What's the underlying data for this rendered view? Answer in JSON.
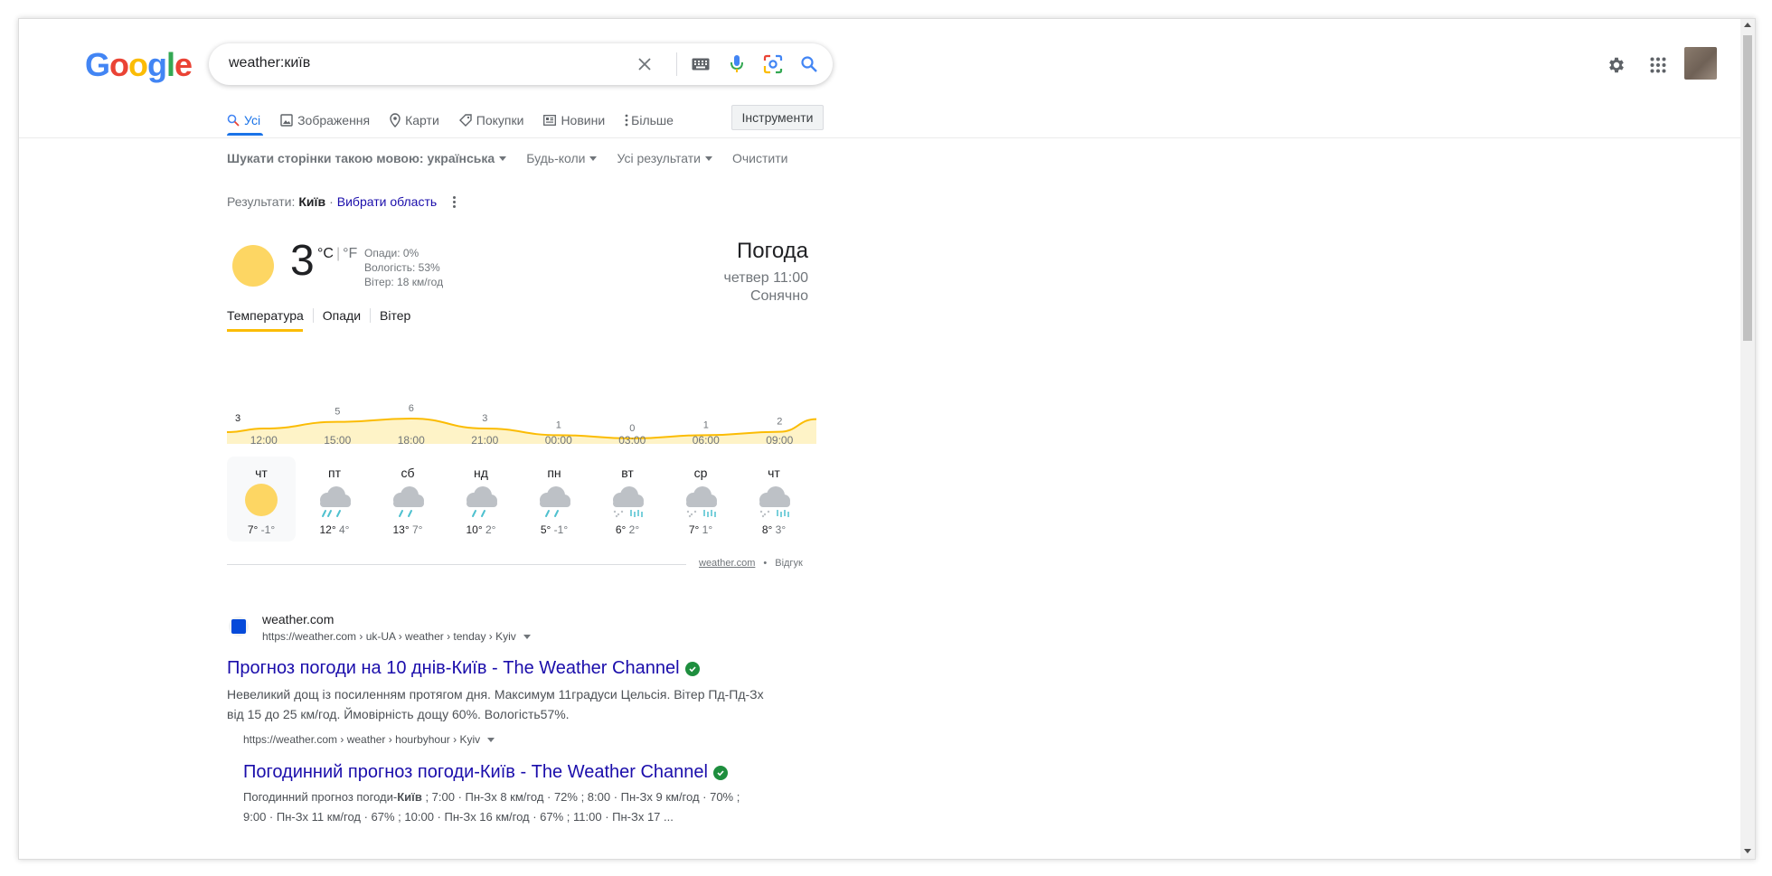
{
  "logo": {
    "text": "Google",
    "colors": [
      "#4285F4",
      "#EA4335",
      "#FBBC05",
      "#4285F4",
      "#34A853",
      "#EA4335"
    ]
  },
  "search": {
    "value": "weather:київ",
    "icons": [
      "close-icon",
      "keyboard-icon",
      "mic-icon",
      "lens-icon",
      "search-icon"
    ]
  },
  "header_right": {
    "icons": [
      "gear-icon",
      "apps-grid-icon",
      "avatar"
    ]
  },
  "tabs": [
    {
      "label": "Усі",
      "icon": "search-icon",
      "active": true
    },
    {
      "label": "Зображення",
      "icon": "image-icon"
    },
    {
      "label": "Карти",
      "icon": "map-pin-icon"
    },
    {
      "label": "Покупки",
      "icon": "tag-icon"
    },
    {
      "label": "Новини",
      "icon": "news-icon"
    },
    {
      "label": "Більше",
      "icon": "more-vert-icon"
    }
  ],
  "tools_label": "Інструменти",
  "filters": [
    {
      "label": "Шукати сторінки такою мовою: українська",
      "caret": true
    },
    {
      "label": "Будь-коли",
      "caret": true
    },
    {
      "label": "Усі результати",
      "caret": true
    },
    {
      "label": "Очистити",
      "caret": false
    }
  ],
  "results_for": {
    "prefix": "Результати:",
    "place": "Київ",
    "separator": "·",
    "choose_area": "Вибрати область"
  },
  "weather": {
    "temp": "3",
    "unit_c": "°C",
    "unit_sep": "|",
    "unit_f": "°F",
    "precip": "Опади: 0%",
    "humidity": "Вологість: 53%",
    "wind": "Вітер: 18 км/год",
    "title": "Погода",
    "datetime": "четвер 11:00",
    "condition": "Сонячно",
    "tabs": [
      "Температура",
      "Опади",
      "Вітер"
    ],
    "accent": "#fbbc04"
  },
  "chart_data": {
    "type": "area",
    "x": [
      "12:00",
      "15:00",
      "18:00",
      "21:00",
      "00:00",
      "03:00",
      "06:00",
      "09:00"
    ],
    "values": [
      3,
      5,
      6,
      3,
      1,
      0,
      1,
      2
    ],
    "labels": [
      "3",
      "5",
      "6",
      "3",
      "1",
      "0",
      "1",
      "2"
    ],
    "color": "#fbbc04"
  },
  "forecast": [
    {
      "day": "чт",
      "hi": "7°",
      "lo": "-1°",
      "icon": "sun-icon"
    },
    {
      "day": "пт",
      "hi": "12°",
      "lo": "4°",
      "icon": "rain-cloud-icon"
    },
    {
      "day": "сб",
      "hi": "13°",
      "lo": "7°",
      "icon": "rain-cloud-icon"
    },
    {
      "day": "нд",
      "hi": "10°",
      "lo": "2°",
      "icon": "rain-cloud-icon"
    },
    {
      "day": "пн",
      "hi": "5°",
      "lo": "-1°",
      "icon": "rain-cloud-icon"
    },
    {
      "day": "вт",
      "hi": "6°",
      "lo": "2°",
      "icon": "sleet-cloud-icon"
    },
    {
      "day": "ср",
      "hi": "7°",
      "lo": "1°",
      "icon": "sleet-cloud-icon"
    },
    {
      "day": "чт",
      "hi": "8°",
      "lo": "3°",
      "icon": "sleet-cloud-icon"
    }
  ],
  "source": {
    "site": "weather.com",
    "dot": "•",
    "feedback": "Відгук"
  },
  "results": [
    {
      "site": "weather.com",
      "url": "https://weather.com › uk-UA › weather › tenday › Kyiv",
      "title": "Прогноз погоди на 10 днів-Київ - The Weather Channel",
      "snippet_1": "Невеликий дощ із посиленням протягом дня. Максимум 11градуси Цельсія. Вітер Пд-Пд-Зх",
      "snippet_2": "від 15 до 25 км/год. Ймовірність дощу 60%. Вологість57%."
    },
    {
      "url": "https://weather.com › weather › hourbyhour › Kyiv",
      "title": "Погодинний прогноз погоди-Київ - The Weather Channel",
      "snippet_1_pre": "Погодинний прогноз погоди-",
      "snippet_1_bold": "Київ",
      "snippet_1_post": " ; 7:00 · Пн-Зх 8 км/год · 72% ; 8:00 · Пн-Зх 9 км/год · 70% ;",
      "snippet_2": "9:00 · Пн-Зх 11 км/год · 67% ; 10:00 · Пн-Зх 16 км/год · 67% ; 11:00 · Пн-Зх 17 ..."
    }
  ]
}
